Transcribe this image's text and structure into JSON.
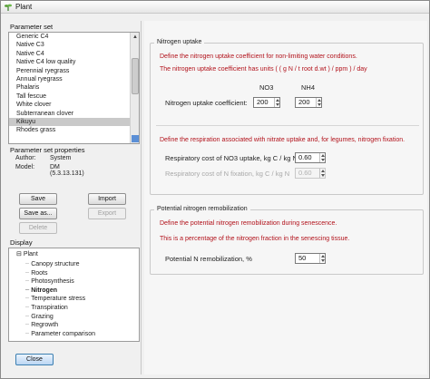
{
  "window": {
    "title": "Plant"
  },
  "parameter_set": {
    "label": "Parameter set",
    "items": [
      "Generic C4",
      "Native C3",
      "Native C4",
      "Native C4 low quality",
      "Perennial ryegrass",
      "Annual ryegrass",
      "Phalaris",
      "Tall fescue",
      "White clover",
      "Subterranean clover",
      "Kikuyu",
      "Rhodes grass"
    ],
    "selected": "Kikuyu"
  },
  "properties": {
    "label": "Parameter set properties",
    "author_label": "Author:",
    "author_value": "System",
    "model_label": "Model:",
    "model_value": "DM (5.3.13.131)"
  },
  "buttons": {
    "save": "Save",
    "import": "Import",
    "save_as": "Save as...",
    "export": "Export",
    "delete": "Delete",
    "close": "Close"
  },
  "display": {
    "label": "Display",
    "root": "Plant",
    "items": [
      "Canopy structure",
      "Roots",
      "Photosynthesis",
      "Nitrogen",
      "Temperature stress",
      "Transpiration",
      "Grazing",
      "Regrowth",
      "Parameter comparison"
    ],
    "selected": "Nitrogen"
  },
  "nitrogen_uptake": {
    "title": "Nitrogen uptake",
    "desc1": "Define the nitrogen uptake coefficient for non-limiting water conditions.",
    "desc2": "The nitrogen uptake coefficient has units ( ( g N / t root d.wt ) / ppm ) / day",
    "col_no3": "NO3",
    "col_nh4": "NH4",
    "coef_label": "Nitrogen uptake coefficient:",
    "no3_value": "200",
    "nh4_value": "200",
    "resp_desc": "Define the respiration associated with nitrate uptake and, for legumes, nitrogen fixation.",
    "resp_no3_label": "Respiratory cost of NO3 uptake, kg C / kg N",
    "resp_no3_value": "0.60",
    "resp_fix_label": "Respiratory cost of N fixation, kg C / kg N",
    "resp_fix_value": "0.60"
  },
  "remobilization": {
    "title": "Potential nitrogen remobilization",
    "desc1": "Define the potential nitrogen remobilization during senescence.",
    "desc2": "This is a percentage of the nitrogen fraction in the senescing tissue.",
    "label": "Potential N remobilization, %",
    "value": "50"
  }
}
